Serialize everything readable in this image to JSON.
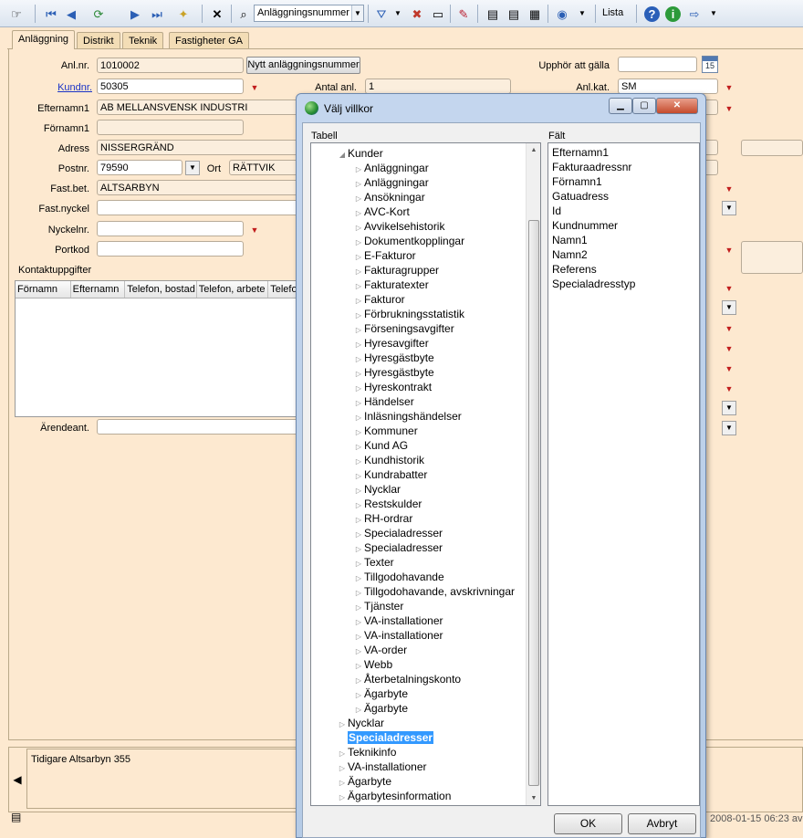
{
  "toolbar": {
    "field_select_value": "Anläggningsnummer",
    "lista_label": "Lista"
  },
  "tabs": [
    {
      "label": "Anläggning",
      "active": true
    },
    {
      "label": "Distrikt"
    },
    {
      "label": "Teknik"
    },
    {
      "label": "Fastigheter GA"
    }
  ],
  "form": {
    "anlnr_label": "Anl.nr.",
    "anlnr_value": "1010002",
    "new_number_button": "Nytt anläggningsnummer",
    "upphor_label": "Upphör att gälla",
    "upphor_value": "",
    "calendar_day": "15",
    "kundnr_label": "Kundnr.",
    "kundnr_value": "50305",
    "antal_anl_label": "Antal anl.",
    "antal_anl_value": "1",
    "anlkat_label": "Anl.kat.",
    "anlkat_value": "SM",
    "efternamn_label": "Efternamn1",
    "efternamn_value": "AB MELLANSVENSK INDUSTRI",
    "fornamn_label": "Förnamn1",
    "fornamn_value": "",
    "adress_label": "Adress",
    "adress_value": "NISSERGRÄND",
    "postnr_label": "Postnr.",
    "postnr_value": "79590",
    "ort_label": "Ort",
    "ort_value": "RÄTTVIK",
    "fastbet_label": "Fast.bet.",
    "fastbet_value": "ALTSARBYN",
    "fastnyckel_label": "Fast.nyckel",
    "fastnyckel_value": "",
    "nyckelnr_label": "Nyckelnr.",
    "nyckelnr_value": "",
    "portkod_label": "Portkod",
    "portkod_value": "",
    "kontakt_label": "Kontaktuppgifter",
    "contact_columns": [
      "Förnamn",
      "Efternamn",
      "Telefon, bostad",
      "Telefon, arbete",
      "Telefo"
    ],
    "arendeant_label": "Ärendeant.",
    "arendeant_value": ""
  },
  "bottom": {
    "note_text": "Tidigare Altsarbyn 355",
    "status_date": "2008-01-15 06:23 av"
  },
  "dialog": {
    "title": "Välj villkor",
    "tabell_label": "Tabell",
    "falt_label": "Fält",
    "tree_parent": "Kunder",
    "tree_children": [
      "Anläggningar",
      "Anläggningar",
      "Ansökningar",
      "AVC-Kort",
      "Avvikelsehistorik",
      "Dokumentkopplingar",
      "E-Fakturor",
      "Fakturagrupper",
      "Fakturatexter",
      "Fakturor",
      "Förbrukningsstatistik",
      "Förseningsavgifter",
      "Hyresavgifter",
      "Hyresgästbyte",
      "Hyresgästbyte",
      "Hyreskontrakt",
      "Händelser",
      "Inläsningshändelser",
      "Kommuner",
      "Kund AG",
      "Kundhistorik",
      "Kundrabatter",
      "Nycklar",
      "Restskulder",
      "RH-ordrar",
      "Specialadresser",
      "Specialadresser",
      "Texter",
      "Tillgodohavande",
      "Tillgodohavande, avskrivningar",
      "Tjänster",
      "VA-installationer",
      "VA-installationer",
      "VA-order",
      "Webb",
      "Återbetalningskonto",
      "Ägarbyte",
      "Ägarbyte"
    ],
    "tree_after": [
      {
        "label": "Nycklar",
        "indent": 0
      },
      {
        "label": "Specialadresser",
        "indent": 0,
        "selected": true
      },
      {
        "label": "Teknikinfo",
        "indent": 0
      },
      {
        "label": "VA-installationer",
        "indent": 0
      },
      {
        "label": "Ägarbyte",
        "indent": 0
      },
      {
        "label": "Ägarbytesinformation",
        "indent": 0
      }
    ],
    "fields": [
      "Efternamn1",
      "Fakturaadressnr",
      "Förnamn1",
      "Gatuadress",
      "Id",
      "Kundnummer",
      "Namn1",
      "Namn2",
      "Referens",
      "Specialadresstyp"
    ],
    "ok_label": "OK",
    "cancel_label": "Avbryt"
  }
}
